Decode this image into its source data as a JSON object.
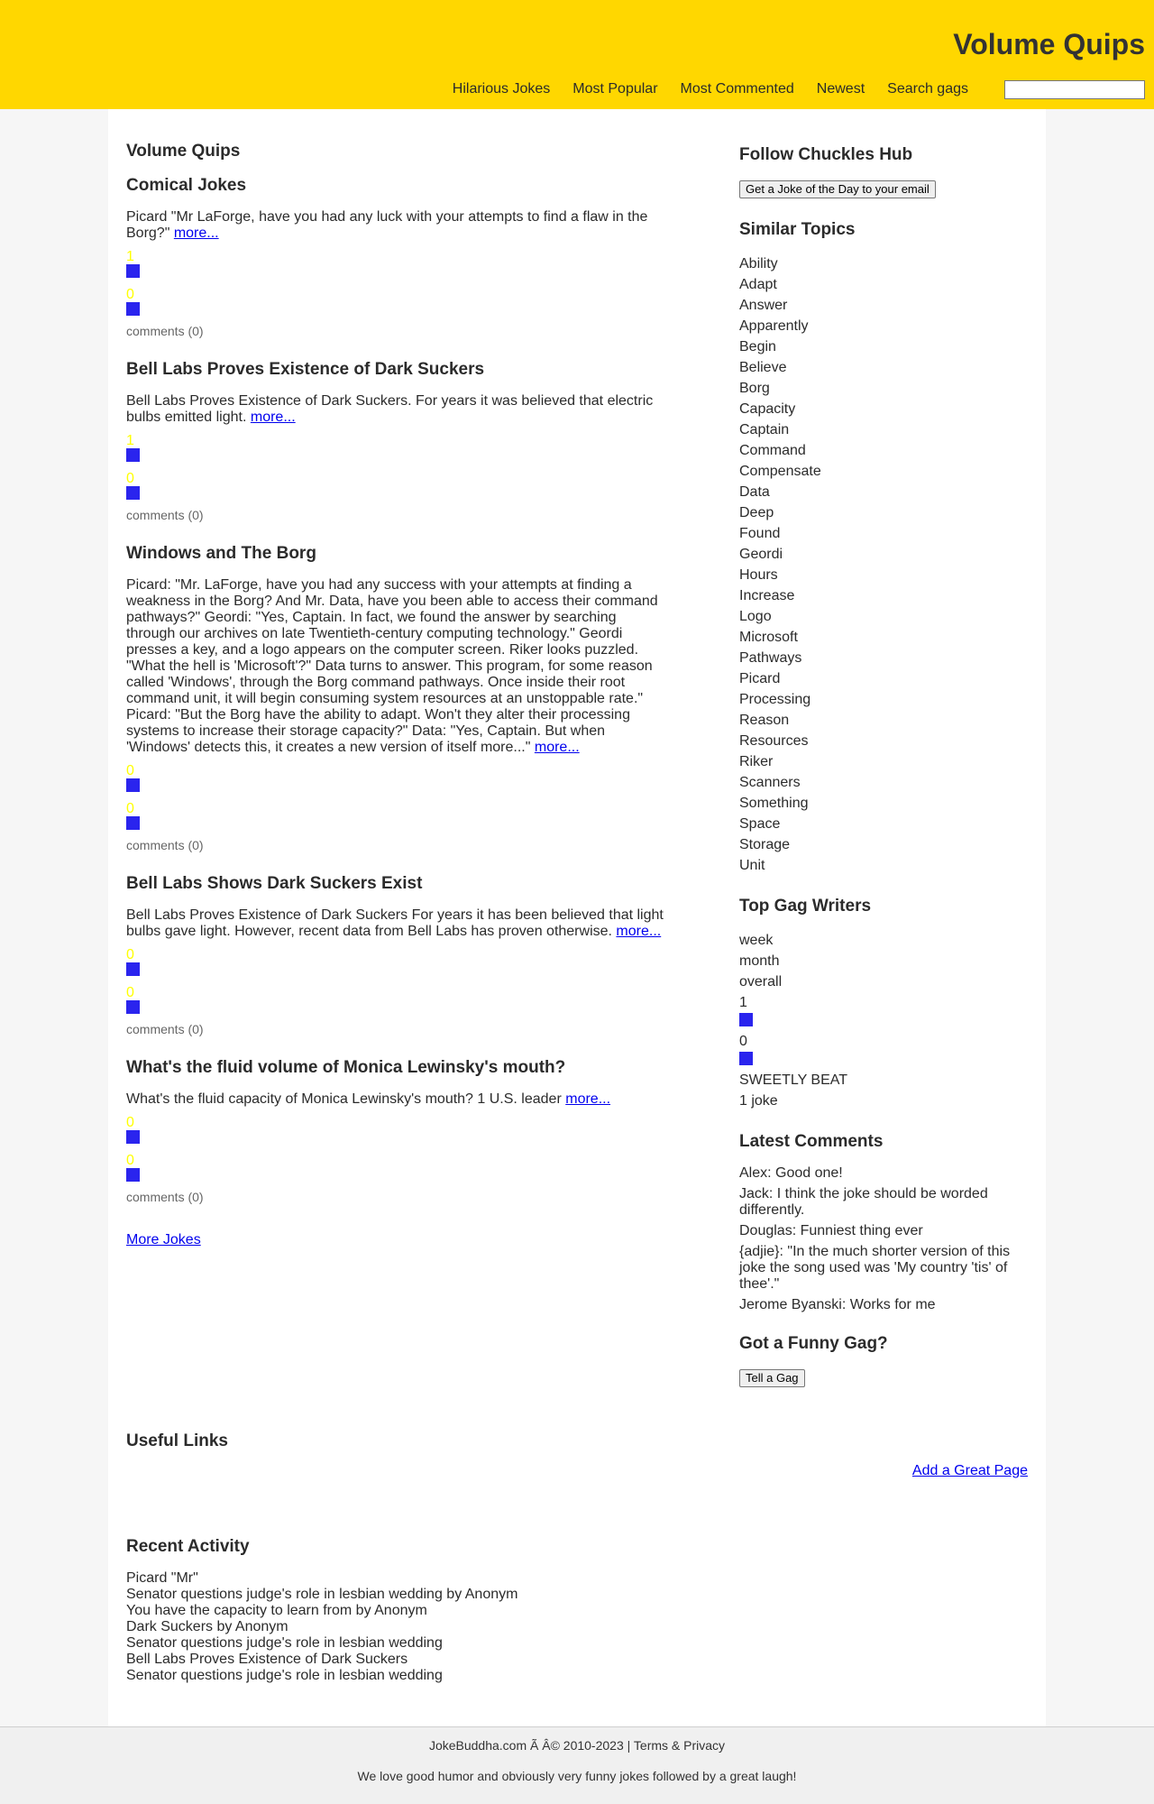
{
  "header": {
    "title": "Volume Quips",
    "nav": [
      "Hilarious Jokes",
      "Most Popular",
      "Most Commented",
      "Newest",
      "Search gags"
    ],
    "search_value": ""
  },
  "main": {
    "section_title": "Volume Quips",
    "jokes": [
      {
        "title": "Comical Jokes",
        "body": "Picard \"Mr LaForge, have you had any luck with your attempts to find a flaw in the Borg?\"",
        "more": "more...",
        "up": "1",
        "down": "0",
        "comments": "comments (0)"
      },
      {
        "title": "Bell Labs Proves Existence of Dark Suckers",
        "body": "Bell Labs Proves Existence of Dark Suckers. For years it was believed that electric bulbs emitted light.",
        "more": "more...",
        "up": "1",
        "down": "0",
        "comments": "comments (0)"
      },
      {
        "title": "Windows and The Borg",
        "body": "Picard: \"Mr. LaForge, have you had any success with your attempts at finding a weakness in the Borg? And Mr. Data, have you been able to access their command pathways?\" Geordi: \"Yes, Captain. In fact, we found the answer by searching through our archives on late Twentieth-century computing technology.\" Geordi presses a key, and a logo appears on the computer screen. Riker looks puzzled. \"What the hell is 'Microsoft'?\" Data turns to answer. This program, for some reason called 'Windows', through the Borg command pathways. Once inside their root command unit, it will begin consuming system resources at an unstoppable rate.\" Picard: \"But the Borg have the ability to adapt. Won't they alter their processing systems to increase their storage capacity?\" Data: \"Yes, Captain. But when 'Windows' detects this, it creates a new version of itself more...\"",
        "more": "more...",
        "up": "0",
        "down": "0",
        "comments": "comments (0)"
      },
      {
        "title": "Bell Labs Shows Dark Suckers Exist",
        "body": "Bell Labs Proves Existence of Dark Suckers For years it has been believed that light bulbs gave light. However, recent data from Bell Labs has proven otherwise.",
        "more": "more...",
        "up": "0",
        "down": "0",
        "comments": "comments (0)"
      },
      {
        "title": "What's the fluid volume of Monica Lewinsky's mouth?",
        "body": "What's the fluid capacity of Monica Lewinsky's mouth? 1 U.S. leader",
        "more": "more...",
        "up": "0",
        "down": "0",
        "comments": "comments (0)"
      }
    ],
    "more_jokes": "More Jokes"
  },
  "sidebar": {
    "follow_title": "Follow Chuckles Hub",
    "follow_button": "Get a Joke of the Day to your email",
    "topics_title": "Similar Topics",
    "topics": [
      "Ability",
      "Adapt",
      "Answer",
      "Apparently",
      "Begin",
      "Believe",
      "Borg",
      "Capacity",
      "Captain",
      "Command",
      "Compensate",
      "Data",
      "Deep",
      "Found",
      "Geordi",
      "Hours",
      "Increase",
      "Logo",
      "Microsoft",
      "Pathways",
      "Picard",
      "Processing",
      "Reason",
      "Resources",
      "Riker",
      "Scanners",
      "Something",
      "Space",
      "Storage",
      "Unit"
    ],
    "writers_title": "Top Gag Writers",
    "periods": [
      "week",
      "month",
      "overall"
    ],
    "writer_up": "1",
    "writer_down": "0",
    "writer_name": "SWEETLY BEAT",
    "writer_count": "1 joke",
    "comments_title": "Latest Comments",
    "comments": [
      "Alex: Good one!",
      "Jack: I think the joke should be worded differently.",
      "Douglas: Funniest thing ever",
      "{adjie}: \"In the much shorter version of this joke the song used was 'My country 'tis' of thee'.\"",
      "Jerome Byanski: Works for me"
    ],
    "gag_title": "Got a Funny Gag?",
    "gag_button": "Tell a Gag"
  },
  "useful": {
    "title": "Useful Links",
    "link": "Add a Great Page"
  },
  "recent": {
    "title": "Recent Activity",
    "items": [
      "Picard \"Mr\"",
      "Senator questions judge's role in lesbian wedding by Anonym",
      "You have the capacity to learn from by Anonym",
      "Dark Suckers by Anonym",
      "Senator questions judge's role in lesbian wedding",
      "Bell Labs Proves Existence of Dark Suckers",
      "Senator questions judge's role in lesbian wedding"
    ]
  },
  "footer": {
    "copyright": "JokeBuddha.com Ã    Â© 2010-2023 | Terms & Privacy",
    "tagline": "We love good humor and obviously very funny jokes followed by a great laugh!"
  },
  "colors": {
    "header_bg": "#ffd700",
    "vote_text": "#ffff00",
    "vote_box": "#2a24ee",
    "link": "#0000ee"
  }
}
